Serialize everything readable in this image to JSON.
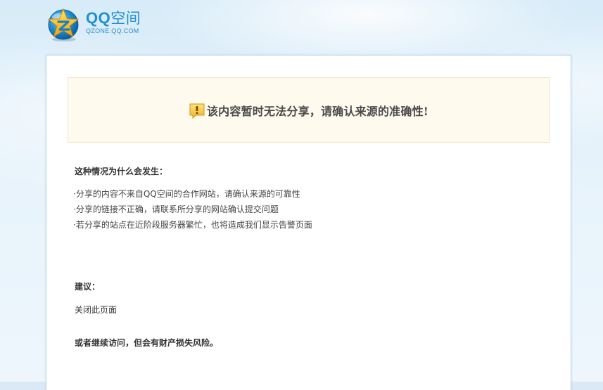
{
  "header": {
    "logo_title_latin": "QQ",
    "logo_title_cn": "空间",
    "logo_subtitle": "QZONE.QQ.COM"
  },
  "notice": {
    "icon": "warning-exclamation-icon",
    "message": "该内容暂时无法分享，请确认来源的准确性!"
  },
  "why": {
    "title": "这种情况为什么会发生：",
    "reasons": [
      "·分享的内容不来自QQ空间的合作网站，请确认来源的可靠性",
      "·分享的链接不正确，请联系所分享的网站确认提交问题",
      "·若分享的站点在近阶段服务器繁忙，也将造成我们显示告警页面"
    ]
  },
  "suggestion": {
    "title": "建议：",
    "close_link": "关闭此页面",
    "continue_text": "或者继续访问，但会有财产损失风险。"
  },
  "colors": {
    "brand_blue": "#1f8fd0",
    "notice_bg": "#fffaee",
    "notice_border": "#f1e3c1",
    "warning_yellow": "#f2c53d"
  }
}
